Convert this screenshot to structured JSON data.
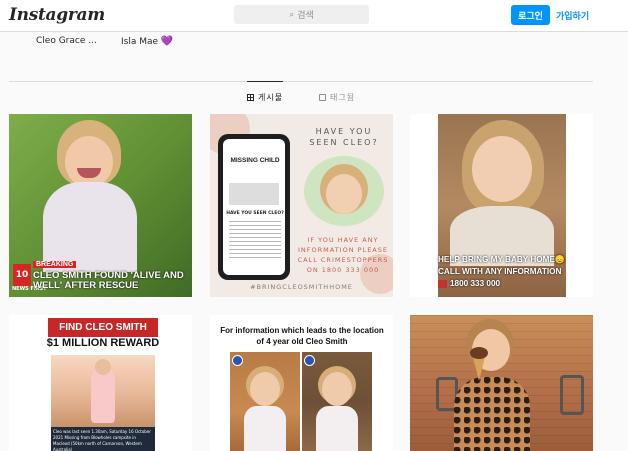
{
  "header": {
    "logo_text": "Instagram",
    "search_placeholder": "검색",
    "login_label": "로그인",
    "signup_label": "가입하기"
  },
  "highlights": [
    {
      "label": "Cleo Grace ..."
    },
    {
      "label": "Isla Mae",
      "emoji": "💜"
    }
  ],
  "tabs": [
    {
      "label": "게시물",
      "active": true
    },
    {
      "label": "태그됨",
      "active": false
    }
  ],
  "posts": [
    {
      "breaking": "BREAKING",
      "headline": "CLEO SMITH FOUND 'ALIVE AND WELL' AFTER RESCUE",
      "channel_number": "10",
      "channel_name": "NEWS FIRST"
    },
    {
      "missing_title": "MISSING CHILD",
      "phone_subtitle": "HAVE YOU SEEN CLEO?",
      "heading": "HAVE YOU SEEN CLEO?",
      "info_text": "IF YOU HAVE ANY INFORMATION PLEASE CALL CRIMESTOPPERS ON 1800 333 000",
      "hashtag": "#BRINGCLEOSMITHHOME"
    },
    {
      "line1": "HELP BRING MY BABY HOME😞",
      "line2": "CALL WITH ANY INFORMATION",
      "phone": "1800 333 000"
    },
    {
      "title": "FIND CLEO SMITH",
      "reward": "$1 MILLION REWARD",
      "caption": "Cleo was last seen 1.30am, Saturday 16 October 2021 Missing from Blowholes campsite in Macleod (50km north of Carnarvon, Western Australia)"
    },
    {
      "info": "For information which leads to the location of 4 year old Cleo Smith"
    },
    {}
  ],
  "colors": {
    "accent_blue": "#0095f6",
    "alert_red": "#c62828",
    "tagged_icon": "tag-icon",
    "posts_icon": "grid-icon"
  }
}
